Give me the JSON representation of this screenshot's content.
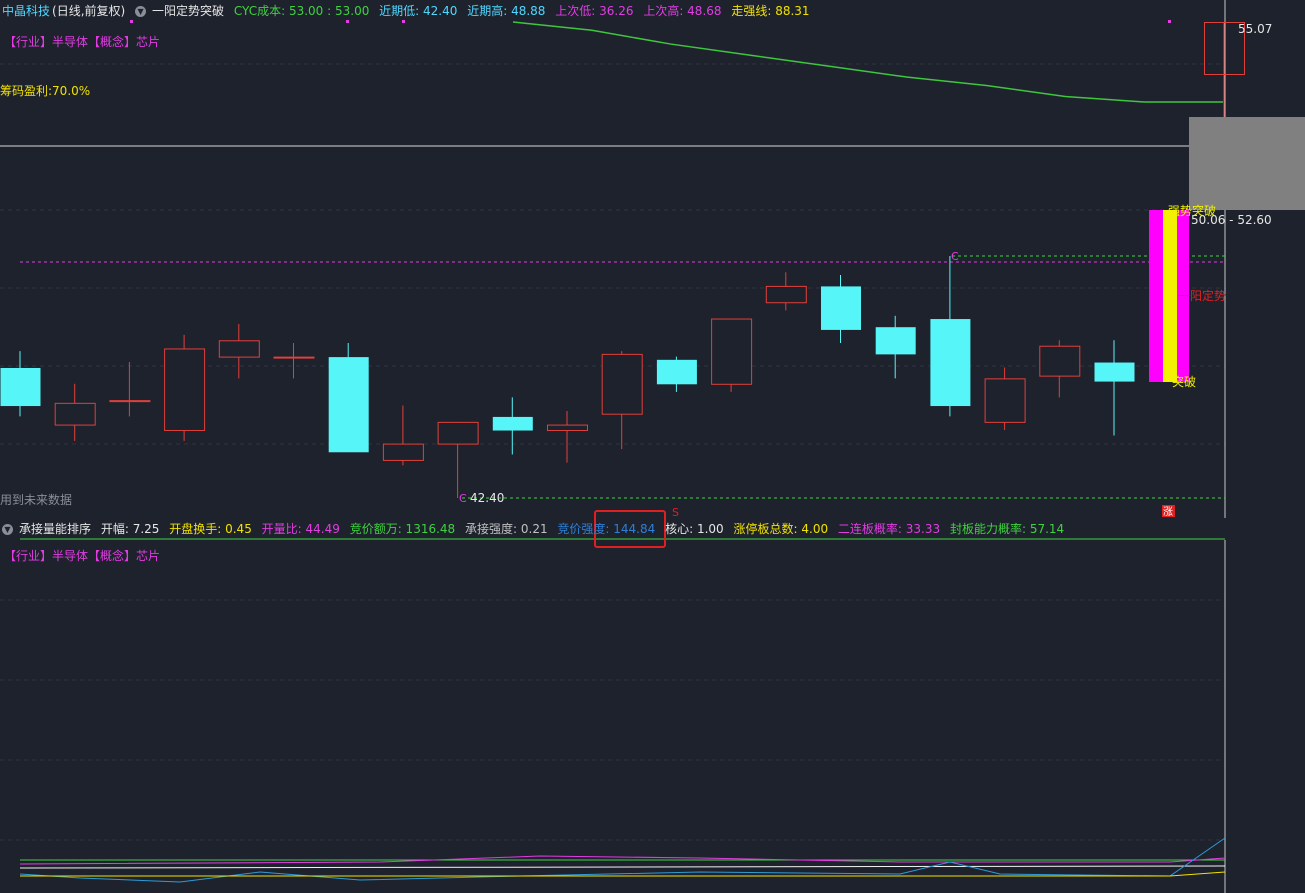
{
  "header": {
    "stock_name": "中晶科技",
    "period": "(日线,前复权)",
    "collapse_icon": "chevron-down-icon",
    "indicator_name": "一阳定势突破",
    "cyc_cost": "CYC成本: 53.00 : 53.00",
    "recent_low": "近期低: 42.40",
    "recent_high": "近期高: 48.88",
    "prev_low": "上次低: 36.26",
    "prev_high": "上次高: 48.68",
    "strong_line": "走强线: 88.31"
  },
  "tags": {
    "industry_label": "【行业】",
    "industry_value": "半导体",
    "concept_label": "【概念】",
    "concept_value": "芯片"
  },
  "chip_profit": "筹码盈利:70.0%",
  "future_data_note": "用到未来数据",
  "price_labels": {
    "high_value": "55.07",
    "range_value": "50.06 - 52.60",
    "low_value": "42.40",
    "low_marker": "C",
    "high_marker": "C",
    "s_marker": "S",
    "zhang_marker": "涨"
  },
  "signals": {
    "strong_breakout": "强势突破",
    "yiyang_dingshi": "一阳定势",
    "breakout": "突破"
  },
  "indicator_header": {
    "name": "承接量能排序",
    "open_range": "开幅: 7.25",
    "open_turnover": "开盘换手: 0.45",
    "open_ratio": "开量比: 44.49",
    "bid_amount": "竞价额万: 1316.48",
    "accept_strength": "承接强度: 0.21",
    "bid_strength": "竞价强度: 144.84",
    "core": "核心: 1.00",
    "limit_up_total": "涨停板总数: 4.00",
    "second_board_rate": "二连板概率: 33.33",
    "seal_ability_rate": "封板能力概率: 57.14"
  },
  "colors": {
    "background": "#1e222d",
    "up": "#e0403a",
    "down": "#55f5f8",
    "green_line": "#3fc63f",
    "magenta": "#e23ce2",
    "yellow": "#f2f200",
    "highlight_box": "#e02020"
  },
  "chart_data": {
    "type": "candlestick",
    "candles": [
      {
        "open": 47.2,
        "close": 45.8,
        "high": 47.8,
        "low": 45.4
      },
      {
        "open": 45.1,
        "close": 45.9,
        "high": 46.6,
        "low": 44.5
      },
      {
        "open": 46.0,
        "close": 46.0,
        "high": 47.4,
        "low": 45.4
      },
      {
        "open": 44.9,
        "close": 47.9,
        "high": 48.4,
        "low": 44.5
      },
      {
        "open": 47.6,
        "close": 48.2,
        "high": 48.8,
        "low": 46.8
      },
      {
        "open": 47.6,
        "close": 47.6,
        "high": 48.1,
        "low": 46.8
      },
      {
        "open": 47.6,
        "close": 44.1,
        "high": 48.1,
        "low": 44.1
      },
      {
        "open": 43.8,
        "close": 44.4,
        "high": 45.8,
        "low": 43.6
      },
      {
        "open": 44.4,
        "close": 45.2,
        "high": 45.2,
        "low": 42.4
      },
      {
        "open": 45.4,
        "close": 44.9,
        "high": 46.1,
        "low": 44.0
      },
      {
        "open": 44.9,
        "close": 45.1,
        "high": 45.6,
        "low": 43.7
      },
      {
        "open": 45.5,
        "close": 47.7,
        "high": 47.8,
        "low": 44.2
      },
      {
        "open": 47.5,
        "close": 46.6,
        "high": 47.6,
        "low": 46.3
      },
      {
        "open": 46.6,
        "close": 49.0,
        "high": 49.0,
        "low": 46.3
      },
      {
        "open": 49.6,
        "close": 50.2,
        "high": 50.7,
        "low": 49.3
      },
      {
        "open": 50.2,
        "close": 48.6,
        "high": 50.6,
        "low": 48.1
      },
      {
        "open": 48.7,
        "close": 47.7,
        "high": 49.1,
        "low": 46.8
      },
      {
        "open": 49.0,
        "close": 45.8,
        "high": 51.3,
        "low": 45.4
      },
      {
        "open": 45.2,
        "close": 46.8,
        "high": 47.2,
        "low": 44.9
      },
      {
        "open": 46.9,
        "close": 48.0,
        "high": 48.2,
        "low": 46.1
      },
      {
        "open": 47.4,
        "close": 46.7,
        "high": 48.2,
        "low": 44.7
      }
    ],
    "final_candle": {
      "open": 48.6,
      "close": 52.2,
      "high": 55.07,
      "low": 44.8
    },
    "signal_bar": {
      "top": 52.6,
      "bottom": 46.7
    },
    "ref_lines": {
      "low": 42.4,
      "high_dashed": 51.3,
      "magenta_dashed": 51.0
    },
    "strong_line_series": [
      53.2,
      52.9,
      52.4,
      52.0,
      51.6,
      51.2,
      50.9,
      50.5,
      50.3,
      50.3
    ]
  }
}
